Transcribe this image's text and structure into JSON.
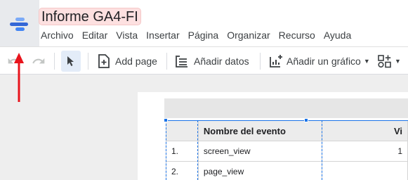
{
  "header": {
    "title": "Informe GA4-FI",
    "menu": [
      "Archivo",
      "Editar",
      "Vista",
      "Insertar",
      "Página",
      "Organizar",
      "Recurso",
      "Ayuda"
    ]
  },
  "toolbar": {
    "add_page_label": "Add page",
    "add_data_label": "Añadir datos",
    "add_chart_label": "Añadir un gráfico"
  },
  "table": {
    "headers": [
      "",
      "Nombre del evento",
      "Vi"
    ],
    "rows": [
      [
        "1.",
        "screen_view",
        "1"
      ],
      [
        "2.",
        "page_view",
        ""
      ]
    ]
  },
  "colors": {
    "accent": "#1a73e8",
    "logo_dark": "#3367d6",
    "logo_mid": "#4285f4",
    "logo_light": "#7baaf7",
    "title_highlight": "#fde0e0",
    "arrow": "#e8141c"
  },
  "icons": {
    "logo": "looker-studio-logo-icon",
    "undo": "undo-icon",
    "redo": "redo-icon",
    "select": "cursor-select-icon",
    "add_page": "add-page-icon",
    "add_data": "add-data-icon",
    "add_chart": "add-chart-icon",
    "controls": "add-control-icon"
  }
}
